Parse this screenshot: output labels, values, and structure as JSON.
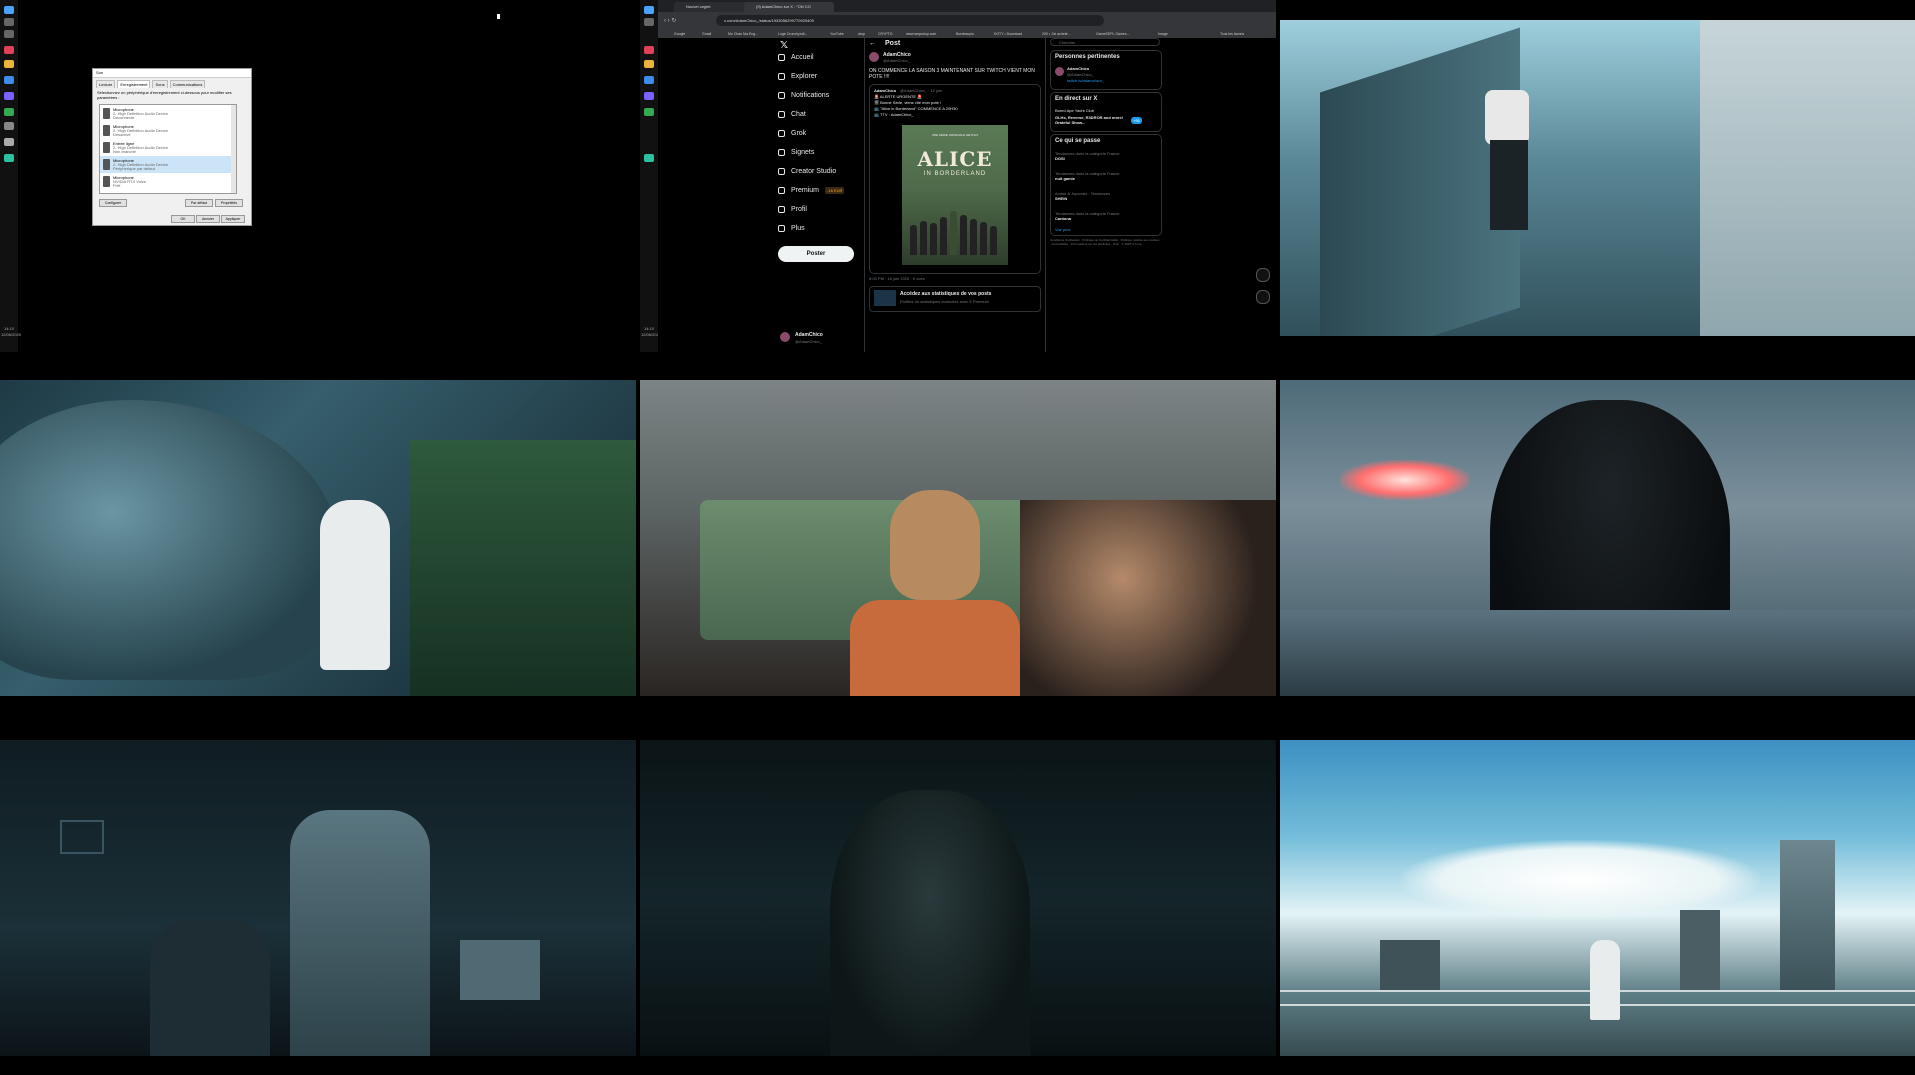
{
  "desktop": {
    "taskbar_time": "14:10",
    "taskbar_date": "12/06/2025"
  },
  "sound_dialog": {
    "title": "Son",
    "tabs": [
      "Lecture",
      "Enregistrement",
      "Sons",
      "Communications"
    ],
    "description": "Sélectionnez un périphérique d'enregistrement ci-dessous pour modifier ses paramètres :",
    "devices": [
      {
        "name": "Microphone",
        "sub": "2- High Definition Audio Device",
        "state": "Déconnecté"
      },
      {
        "name": "Microphone",
        "sub": "2- High Definition Audio Device",
        "state": "Désactivé"
      },
      {
        "name": "Entrée ligne",
        "sub": "2- High Definition Audio Device",
        "state": "Non branché"
      },
      {
        "name": "Microphone",
        "sub": "2- High Definition Audio Device",
        "state": "Périphérique par défaut"
      },
      {
        "name": "Microphone",
        "sub": "NVIDIA RTX Voice",
        "state": "Prêt"
      }
    ],
    "configure_label": "Configurer",
    "default_label": "Par défaut",
    "properties_label": "Propriétés",
    "ok_label": "OK",
    "cancel_label": "Annuler",
    "apply_label": "Appliquer"
  },
  "browser": {
    "tabs": [
      "Nouvel onglet",
      "(9) AdamChico sur X : \"ON CO"
    ],
    "url": "x.com/AdamChico_/status/1933056299770925409",
    "bookmarks": [
      "Google",
      "Gmail",
      "Mo Chan Ma Eng...",
      "Loge Crunchyroll...",
      "YouTube",
      "drop",
      "CRYPTO",
      "www.seqsdrop.com",
      "Bordeaupio",
      "KOTY • Download",
      "200 • J'ai acheté...",
      "GameSEPL Games...",
      "Image",
      "Tous les favoris"
    ],
    "nav": [
      "Accueil",
      "Explorer",
      "Notifications",
      "Chat",
      "Grok",
      "Signets",
      "Creator Studio",
      "Premium",
      "Profil",
      "Plus"
    ],
    "premium_badge": "-16 EUR",
    "post_button": "Poster",
    "account_name": "AdamChico",
    "account_handle": "@AdamChico_",
    "post_header": "Post",
    "post_author": "AdamChico",
    "post_handle": "@AdamChico_",
    "post_text": "ON COMMENCE LA SAISON 3 MAINTENANT SUR TWITCH VIENT MON POTE !!!!",
    "quoted_author": "AdamChico",
    "quoted_handle": "@AdamChico_ · 12 juin",
    "quoted_lines": [
      "🚨 ALERTE URGENTE 🚨",
      "🎬 Bonne Série, viens vite mon pote !",
      "📺 \"Alice in Borderland\" COMMENCE A 20H30",
      "📺 TTV : AdamChico_"
    ],
    "poster_top": "UNE SÉRIE ORIGINALE NETFLIX",
    "poster_title": "ALICE",
    "poster_sub": "IN BORDERLAND",
    "post_meta": "8:03 PM · 18 juin 2025 · 6 vues",
    "stats_cta": "Accédez aux statistiques de vos posts",
    "stats_sub": "Profitez de statistiques avancées avec X Premium",
    "search_placeholder": "Chercher",
    "relevant_title": "Personnes pertinentes",
    "relevant_name": "AdamChico",
    "relevant_handle": "@AdamChico_",
    "relevant_bio": "twitch.tv/adamchico_",
    "live_title": "En direct sur X",
    "live_host": "Bored Ape Yacht Club",
    "live_text": "GLHs, Reverse, R3DROR and more! Grateful Show...",
    "live_count": "+95",
    "trends_title": "Ce qui se passe",
    "trends": [
      {
        "meta": "Tendances dans la catégorie France",
        "name": "DGSI"
      },
      {
        "meta": "Tendances dans la catégorie France",
        "name": "nuit gamie"
      },
      {
        "meta": "Animé & Japonais · Tendances",
        "name": "SHEIN"
      },
      {
        "meta": "Tendances dans la catégorie France",
        "name": "Cantona"
      }
    ],
    "show_more": "Voir plus",
    "footer": "Conditions d'utilisation · Politique de Confidentialité · Politique relative aux cookies · Accessibilité · Informations sur les publicités · Plus · © 2025 X Corp."
  },
  "colors": {
    "x_bg": "#000000",
    "x_accent": "#1d9bf0",
    "x_text": "#e7e9ea",
    "x_muted": "#71767b",
    "dialog_bg": "#f0f0f0"
  }
}
